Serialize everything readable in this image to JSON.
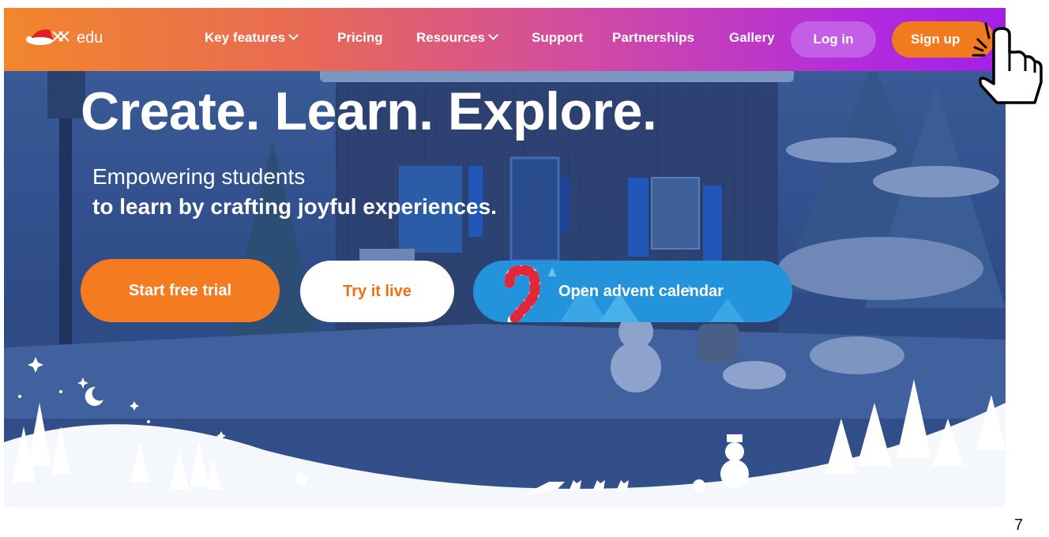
{
  "brand": {
    "logo_text": "edu"
  },
  "nav": {
    "items": [
      {
        "label": "Key features",
        "has_dropdown": true
      },
      {
        "label": "Pricing",
        "has_dropdown": false
      },
      {
        "label": "Resources",
        "has_dropdown": true
      },
      {
        "label": "Support",
        "has_dropdown": false
      },
      {
        "label": "Partnerships",
        "has_dropdown": false
      },
      {
        "label": "Gallery",
        "has_dropdown": false
      }
    ],
    "login_label": "Log in",
    "signup_label": "Sign up"
  },
  "hero": {
    "title": "Create. Learn. Explore.",
    "subtitle_line1": "Empowering students",
    "subtitle_line2": "to learn by crafting joyful experiences.",
    "buttons": {
      "trial": "Start free trial",
      "live": "Try it live",
      "advent": "Open advent calendar"
    }
  },
  "page_number": "7",
  "colors": {
    "accent_orange": "#f47b20",
    "nav_gradient_start": "#f2862c",
    "nav_gradient_end": "#a220e6",
    "advent_blue": "#2394db",
    "hero_bg": "#33528f"
  }
}
